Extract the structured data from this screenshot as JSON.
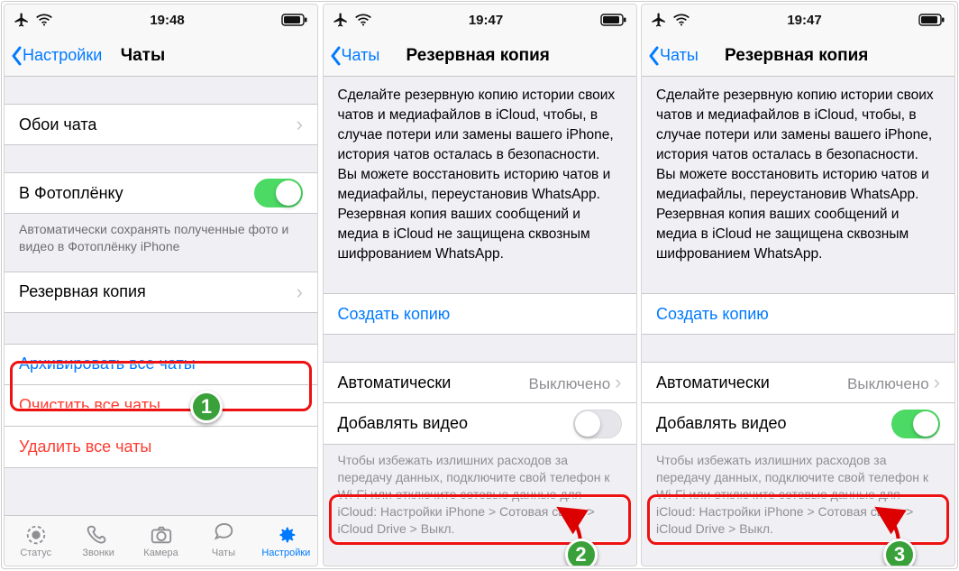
{
  "statusbar": {
    "time1": "19:48",
    "time2": "19:47",
    "time3": "19:47"
  },
  "p1": {
    "back": "Настройки",
    "title": "Чаты",
    "wallpaper": "Обои чата",
    "to_camera_roll": "В Фотоплёнку",
    "note_camera_roll": "Автоматически сохранять полученные фото и видео в Фотоплёнку iPhone",
    "backup": "Резервная копия",
    "archive_all": "Архивировать все чаты",
    "clear_all": "Очистить все чаты",
    "delete_all": "Удалить все чаты",
    "tabs": {
      "status": "Статус",
      "calls": "Звонки",
      "camera": "Камера",
      "chats": "Чаты",
      "settings": "Настройки"
    }
  },
  "p2": {
    "back": "Чаты",
    "title": "Резервная копия",
    "desc": "Сделайте резервную копию истории своих чатов и медиафайлов в iCloud, чтобы, в случае потери или замены вашего iPhone, история чатов осталась в безопасности. Вы можете восстановить историю чатов и медиафайлы, переустановив WhatsApp. Резервная копия ваших сообщений и медиа в iCloud не защищена сквозным шифрованием WhatsApp.",
    "create": "Создать копию",
    "auto": "Автоматически",
    "auto_value": "Выключено",
    "include_video": "Добавлять видео",
    "foot": "Чтобы избежать излишних расходов за передачу данных, подключите свой телефон к Wi-Fi или отключите сотовые данные для iCloud: Настройки iPhone > Сотовая связь > iCloud Drive > Выкл."
  },
  "badges": {
    "b1": "1",
    "b2": "2",
    "b3": "3"
  },
  "colors": {
    "accent": "#007aff",
    "green": "#4cd964",
    "red": "#ff3b30",
    "highlight": "#e11",
    "badge1": "#3aa13a",
    "badge2": "#3aa13a",
    "badge3": "#3aa13a"
  }
}
